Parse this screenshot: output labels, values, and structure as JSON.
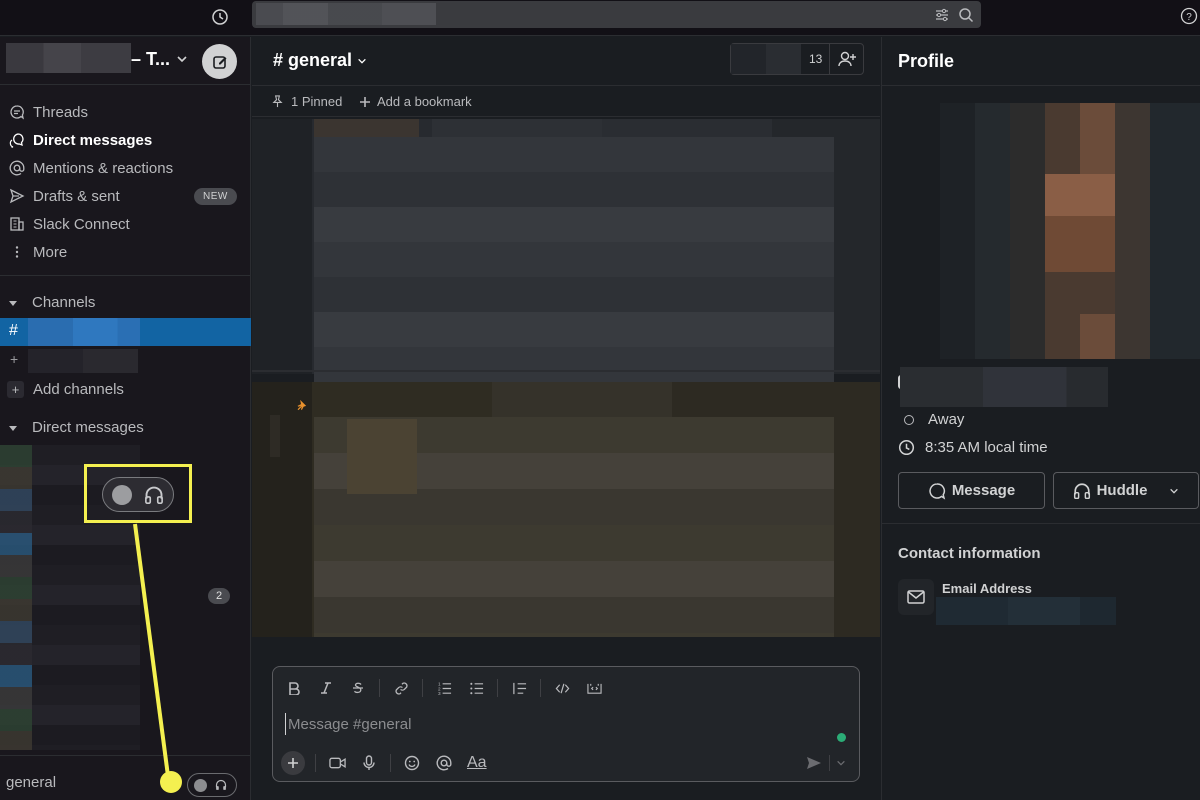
{
  "topbar": {
    "search_placeholder": ""
  },
  "workspace": {
    "name_suffix": "– T..."
  },
  "nav": [
    {
      "label": "Threads",
      "icon": "threads-icon"
    },
    {
      "label": "Direct messages",
      "icon": "dm-icon"
    },
    {
      "label": "Mentions & reactions",
      "icon": "at-icon"
    },
    {
      "label": "Drafts & sent",
      "icon": "send-icon",
      "badge": "NEW"
    },
    {
      "label": "Slack Connect",
      "icon": "building-icon"
    },
    {
      "label": "More",
      "icon": "more-icon"
    }
  ],
  "sidebar": {
    "channels_heading": "Channels",
    "add_channels_label": "Add channels",
    "dm_heading": "Direct messages",
    "dm_unread_badge": "2",
    "bottom_channel_label": "general"
  },
  "channel": {
    "title": "# general",
    "member_count": "13",
    "pinned_label": "1 Pinned",
    "bookmark_label": "Add a bookmark"
  },
  "composer": {
    "placeholder": "Message #general",
    "format_label": "Aa",
    "value": ""
  },
  "profile": {
    "heading": "Profile",
    "status": "Away",
    "local_time": "8:35 AM local time",
    "message_button": "Message",
    "huddle_button": "Huddle",
    "contact_heading": "Contact information",
    "email_label": "Email Address"
  },
  "colors": {
    "accent_blue": "#1264a3",
    "highlight_yellow": "#f4f050",
    "online_green": "#2bac76"
  }
}
